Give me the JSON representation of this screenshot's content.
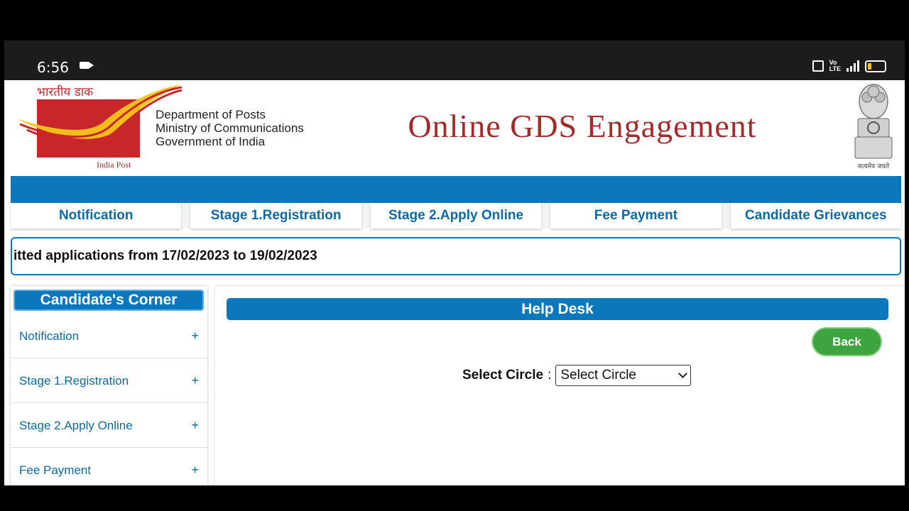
{
  "status_bar": {
    "time": "6:56",
    "icons": [
      "video-record-icon",
      "cast-icon",
      "volte-icon",
      "signal-4g-icon",
      "battery-icon"
    ],
    "volte_label": "Vo\nLTE",
    "network": "4G"
  },
  "header": {
    "logo_hindi": "भारतीय डाक",
    "logo_caption": "India Post",
    "dept_line1": "Department of Posts",
    "dept_line2": "Ministry of Communications",
    "dept_line3": "Government of India",
    "site_title": "Online GDS Engagement",
    "emblem_caption": "सत्यमेव जयते"
  },
  "nav": {
    "items": [
      {
        "label": "Notification"
      },
      {
        "label": "Stage 1.Registration"
      },
      {
        "label": "Stage 2.Apply Online"
      },
      {
        "label": "Fee Payment"
      },
      {
        "label": "Candidate Grievances"
      }
    ]
  },
  "marquee": {
    "text": "itted applications from 17/02/2023 to 19/02/2023"
  },
  "sidebar": {
    "title": "Candidate's Corner",
    "items": [
      {
        "label": "Notification",
        "toggle": "+"
      },
      {
        "label": "Stage 1.Registration",
        "toggle": "+"
      },
      {
        "label": "Stage 2.Apply Online",
        "toggle": "+"
      },
      {
        "label": "Fee Payment",
        "toggle": "+"
      }
    ]
  },
  "main": {
    "section_title": "Help Desk",
    "back_label": "Back",
    "circle_label": "Select Circle",
    "circle_colon": ":",
    "circle_selected": "Select Circle"
  },
  "colors": {
    "primary_blue": "#0b78bd",
    "title_red": "#a52a2a",
    "back_green": "#3da440",
    "logo_red": "#c8262b",
    "logo_yellow": "#f5c518"
  }
}
